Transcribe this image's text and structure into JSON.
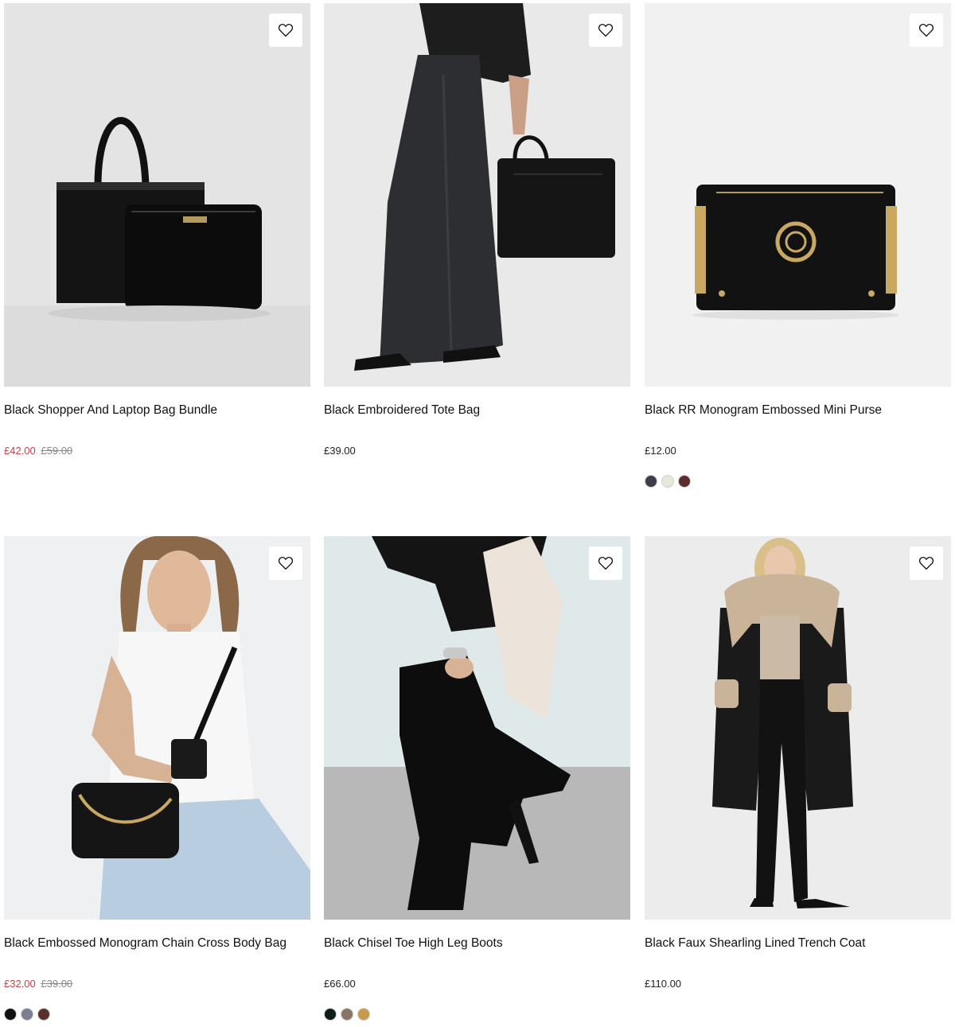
{
  "products": [
    {
      "title": "Black Shopper And Laptop Bag Bundle",
      "price": "£42.00",
      "was_price": "£59.00",
      "on_sale": true,
      "image": "black-shopper-laptop-bag-photo",
      "swatches": []
    },
    {
      "title": "Black Embroidered Tote Bag",
      "price": "£39.00",
      "was_price": "",
      "on_sale": false,
      "image": "black-tote-bag-model-photo",
      "swatches": []
    },
    {
      "title": "Black RR Monogram Embossed Mini Purse",
      "price": "£12.00",
      "was_price": "",
      "on_sale": false,
      "image": "black-mini-purse-photo",
      "swatches": [
        "#3b3f4a",
        "#e6e8dc",
        "#5a2e2a"
      ]
    },
    {
      "title": "Black Embossed Monogram Chain Cross Body Bag",
      "price": "£32.00",
      "was_price": "£39.00",
      "on_sale": true,
      "image": "cross-body-bag-model-photo",
      "swatches": [
        "#111111",
        "#7a7f96",
        "#5a2e2a"
      ]
    },
    {
      "title": "Black Chisel Toe High Leg Boots",
      "price": "£66.00",
      "was_price": "",
      "on_sale": false,
      "image": "high-leg-boots-photo",
      "swatches": [
        "#0f1f1c",
        "#8a7466",
        "#c79a4d"
      ]
    },
    {
      "title": "Black Faux Shearling Lined Trench Coat",
      "price": "£110.00",
      "was_price": "",
      "on_sale": false,
      "image": "shearling-trench-coat-photo",
      "swatches": []
    }
  ],
  "icons": {
    "wishlist": "heart-outline-icon"
  },
  "colors": {
    "sale": "#c0464b",
    "was": "#888888",
    "text": "#111111"
  }
}
